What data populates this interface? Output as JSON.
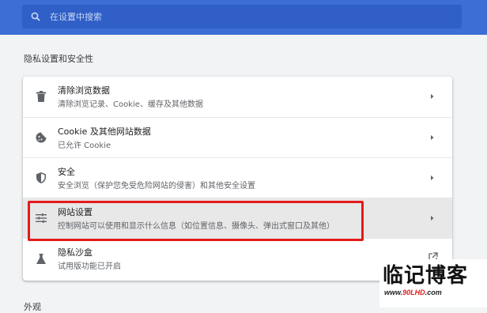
{
  "search": {
    "placeholder": "在设置中搜索"
  },
  "section": {
    "title": "隐私设置和安全性"
  },
  "items": [
    {
      "title": "清除浏览数据",
      "subtitle": "清除浏览记录、Cookie、缓存及其他数据",
      "icon": "trash-icon",
      "action": "chevron-right-icon"
    },
    {
      "title": "Cookie 及其他网站数据",
      "subtitle": "已允许 Cookie",
      "icon": "cookie-icon",
      "action": "chevron-right-icon"
    },
    {
      "title": "安全",
      "subtitle": "安全浏览（保护您免受危险网站的侵害）和其他安全设置",
      "icon": "shield-icon",
      "action": "chevron-right-icon"
    },
    {
      "title": "网站设置",
      "subtitle": "控制网站可以使用和显示什么信息（如位置信息、摄像头、弹出式窗口及其他）",
      "icon": "tune-icon",
      "action": "chevron-right-icon",
      "highlighted": true
    },
    {
      "title": "隐私沙盒",
      "subtitle": "试用版功能已开启",
      "icon": "flask-icon",
      "action": "open-external-icon"
    }
  ],
  "next_section": {
    "title": "外观"
  },
  "watermark": {
    "main": "临记博客",
    "sub_prefix": "www.",
    "sub_highlight": "90LHD",
    "sub_suffix": ".com"
  },
  "colors": {
    "topbar": "#3c6ed6",
    "search_bg": "#2f5fc7",
    "highlight_box": "#e31b1b",
    "page_bg": "#f1f3f4"
  }
}
